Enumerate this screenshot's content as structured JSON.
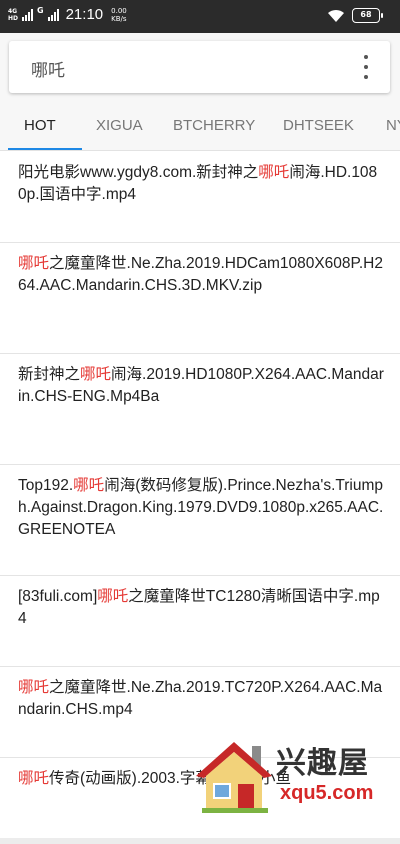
{
  "status_bar": {
    "network_top": "4G",
    "network_sub": "HD",
    "network_right": "G",
    "time": "21:10",
    "speed_value": "0.00",
    "speed_unit": "KB/s",
    "battery": "68"
  },
  "search": {
    "query": "哪吒"
  },
  "tabs": [
    {
      "label": "HOT",
      "active": true
    },
    {
      "label": "XIGUA",
      "active": false
    },
    {
      "label": "BTCHERRY",
      "active": false
    },
    {
      "label": "DHTSEEK",
      "active": false
    },
    {
      "label": "NY",
      "active": false
    }
  ],
  "results": [
    {
      "pre": "阳光电影www.ygdy8.com.新封神之",
      "hl": "哪吒",
      "post": "闹海.HD.1080p.国语中字.mp4"
    },
    {
      "pre": "",
      "hl": "哪吒",
      "post": "之魔童降世.Ne.Zha.2019.HDCam1080X608P.H264.AAC.Mandarin.CHS.3D.MKV.zip"
    },
    {
      "pre": "新封神之",
      "hl": "哪吒",
      "post": "闹海.2019.HD1080P.X264.AAC.Mandarin.CHS-ENG.Mp4Ba"
    },
    {
      "pre": "Top192.",
      "hl": "哪吒",
      "post": "闹海(数码修复版).Prince.Nezha's.Triumph.Against.Dragon.King.1979.DVD9.1080p.x265.AAC.GREENOTEA"
    },
    {
      "pre": "[83fuli.com]",
      "hl": "哪吒",
      "post": "之魔童降世TC1280清晰国语中字.mp4"
    },
    {
      "pre": "",
      "hl": "哪吒",
      "post": "之魔童降世.Ne.Zha.2019.TC720P.X264.AAC.Mandarin.CHS.mp4"
    },
    {
      "pre": "",
      "hl": "哪吒",
      "post": "传奇(动画版).2003.字幕.CMCT小鱼"
    }
  ],
  "watermark": {
    "name": "兴趣屋",
    "url": "xqu5.com"
  },
  "colors": {
    "highlight": "#e53935",
    "accent": "#1e88e5"
  }
}
